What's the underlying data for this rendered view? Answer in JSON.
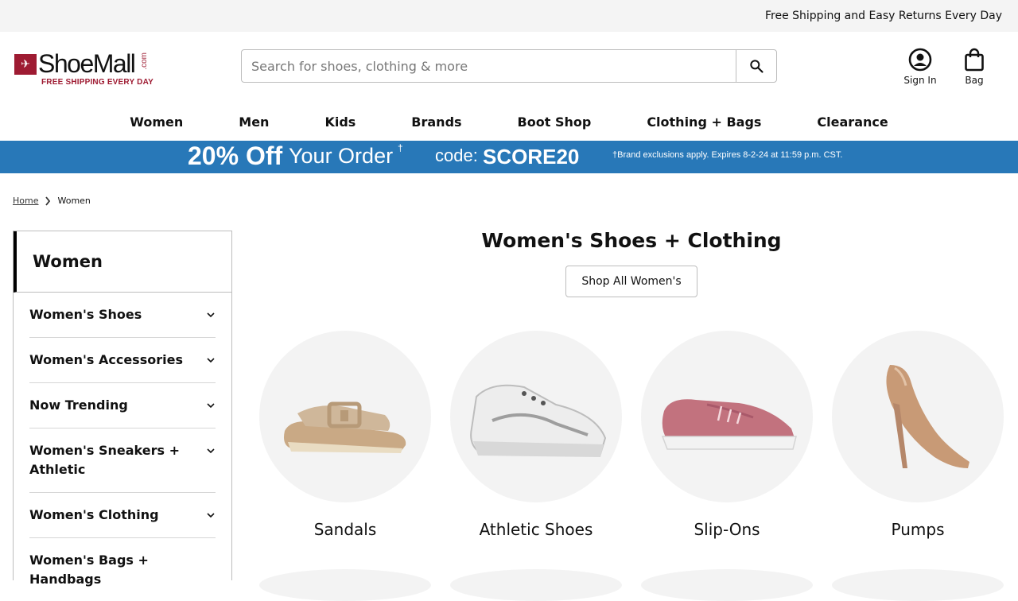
{
  "promo": {
    "text": "Free Shipping and Easy Returns Every Day"
  },
  "logo": {
    "wordmark": "ShoeMall",
    "dotcom": ".com",
    "tagline": "FREE SHIPPING EVERY DAY"
  },
  "search": {
    "placeholder": "Search for shoes, clothing & more"
  },
  "account": {
    "signin_label": "Sign In",
    "bag_label": "Bag"
  },
  "nav": [
    "Women",
    "Men",
    "Kids",
    "Brands",
    "Boot Shop",
    "Clothing + Bags",
    "Clearance"
  ],
  "banner": {
    "offer": "20% Off",
    "offer_sub": "Your Order",
    "dagger": "†",
    "code_label": "code:",
    "code": "SCORE20",
    "fine_print": "†Brand exclusions apply. Expires 8-2-24 at 11:59 p.m. CST."
  },
  "breadcrumb": {
    "home": "Home",
    "current": "Women"
  },
  "sidebar": {
    "title": "Women",
    "items": [
      {
        "label": "Women's Shoes",
        "expandable": true
      },
      {
        "label": "Women's Accessories",
        "expandable": true
      },
      {
        "label": "Now Trending",
        "expandable": true
      },
      {
        "label": "Women's Sneakers + Athletic",
        "expandable": true
      },
      {
        "label": "Women's Clothing",
        "expandable": true
      },
      {
        "label": "Women's Bags + Handbags",
        "expandable": false
      }
    ]
  },
  "main": {
    "title": "Women's Shoes + Clothing",
    "shop_all": "Shop All Women's",
    "categories": [
      {
        "name": "Sandals",
        "icon": "sandal-image"
      },
      {
        "name": "Athletic Shoes",
        "icon": "sneaker-image"
      },
      {
        "name": "Slip-Ons",
        "icon": "slip-on-image"
      },
      {
        "name": "Pumps",
        "icon": "pump-image"
      }
    ]
  },
  "colors": {
    "accent": "#2878b8",
    "brand": "#9e1b32"
  }
}
